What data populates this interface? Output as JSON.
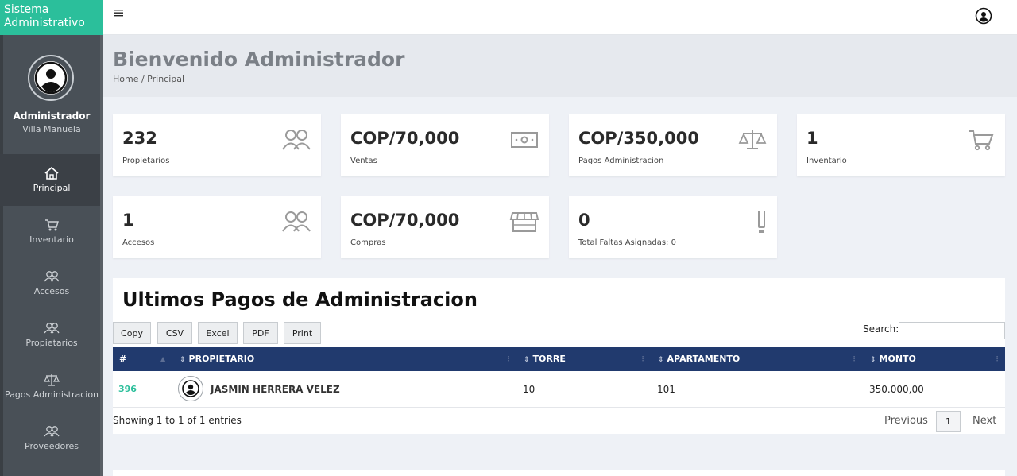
{
  "brand": "Sistema Administrativo",
  "profile": {
    "name": "Administrador",
    "subtitle": "Villa Manuela"
  },
  "sidebar": {
    "items": [
      {
        "label": "Principal",
        "icon": "home-icon",
        "active": true
      },
      {
        "label": "Inventario",
        "icon": "cart-icon"
      },
      {
        "label": "Accesos",
        "icon": "users-icon"
      },
      {
        "label": "Propietarios",
        "icon": "users-icon"
      },
      {
        "label": "Pagos Administracion",
        "icon": "scale-icon"
      },
      {
        "label": "Proveedores",
        "icon": "users-icon"
      }
    ]
  },
  "header": {
    "title": "Bienvenido Administrador",
    "breadcrumb": "Home / Principal"
  },
  "cards": [
    {
      "value": "232",
      "label": "Propietarios",
      "icon": "users-icon"
    },
    {
      "value": "COP/70,000",
      "label": "Ventas",
      "icon": "money-icon"
    },
    {
      "value": "COP/350,000",
      "label": "Pagos Administracion",
      "icon": "scale-icon"
    },
    {
      "value": "1",
      "label": "Inventario",
      "icon": "cart-icon"
    },
    {
      "value": "1",
      "label": "Accesos",
      "icon": "users-icon"
    },
    {
      "value": "COP/70,000",
      "label": "Compras",
      "icon": "store-icon"
    },
    {
      "value": "0",
      "label": "Total Faltas Asignadas: 0",
      "icon": "exclamation-icon"
    }
  ],
  "table": {
    "title": "Ultimos Pagos de Administracion",
    "buttons": [
      "Copy",
      "CSV",
      "Excel",
      "PDF",
      "Print"
    ],
    "search_label": "Search:",
    "search_value": "",
    "columns": [
      "#",
      "PROPIETARIO",
      "TORRE",
      "APARTAMENTO",
      "MONTO"
    ],
    "rows": [
      {
        "id": "396",
        "owner": "JASMIN HERRERA VELEZ",
        "torre": "10",
        "apartamento": "101",
        "monto": "350.000,00"
      }
    ],
    "info": "Showing 1 to 1 of 1 entries",
    "pager": {
      "previous": "Previous",
      "current": "1",
      "next": "Next"
    }
  },
  "colors": {
    "accent": "#2bbf9b",
    "sidebar": "#495057",
    "table_header": "#213a6e"
  }
}
